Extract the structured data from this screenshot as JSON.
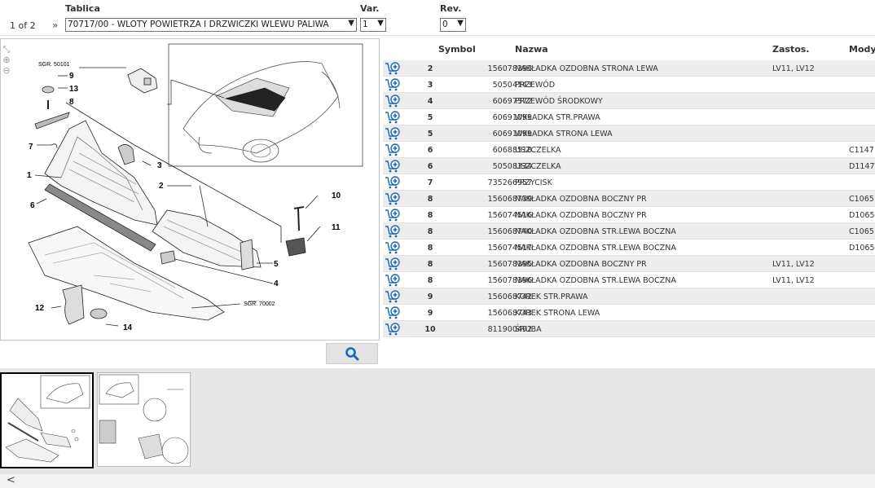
{
  "header": {
    "tablica_label": "Tablica",
    "var_label": "Var.",
    "rev_label": "Rev.",
    "page_indicator": "1 of 2",
    "nav_glyph": "»",
    "table_select": "70717/00 - WLOTY POWIETRZA I DRZWICZKI WLEWU PALIWA",
    "var_select": "1",
    "rev_select": "0"
  },
  "viewer": {
    "tools": [
      "⤡",
      "⊕",
      "⊖"
    ],
    "labels": {
      "sgr1": "SGR. 50101",
      "sgr2": "SGR. 70002",
      "n1": "1",
      "n2": "2",
      "n3": "3",
      "n4": "4",
      "n5": "5",
      "n6": "6",
      "n7": "7",
      "n8": "8",
      "n9": "9",
      "n10": "10",
      "n11": "11",
      "n12": "12",
      "n13": "13",
      "n14": "14"
    }
  },
  "table": {
    "columns": {
      "symbol": "Symbol",
      "nazwa": "Nazwa",
      "zastos": "Zastos.",
      "mody": "Mody"
    },
    "rows": [
      {
        "pos": "2",
        "symbol": "156078393",
        "nazwa": "NAKŁADKA OZDOBNA STRONA LEWA",
        "zastos": "LV11, LV12",
        "mody": ""
      },
      {
        "pos": "3",
        "symbol": "50504143",
        "nazwa": "PRZEWÓD",
        "zastos": "",
        "mody": ""
      },
      {
        "pos": "4",
        "symbol": "60697372",
        "nazwa": "PRZEWÓD ŚRODKOWY",
        "zastos": "",
        "mody": ""
      },
      {
        "pos": "5",
        "symbol": "60691099",
        "nazwa": "WKŁADKA STR.PRAWA",
        "zastos": "",
        "mody": ""
      },
      {
        "pos": "5",
        "symbol": "60691099",
        "nazwa": "WKŁADKA STRONA LEWA",
        "zastos": "",
        "mody": ""
      },
      {
        "pos": "6",
        "symbol": "60688518",
        "nazwa": "USZCZELKA",
        "zastos": "",
        "mody": "C1147"
      },
      {
        "pos": "6",
        "symbol": "50508334",
        "nazwa": "USZCZELKA",
        "zastos": "",
        "mody": "D1147"
      },
      {
        "pos": "7",
        "symbol": "735266957",
        "nazwa": "PRZYCISK",
        "zastos": "",
        "mody": ""
      },
      {
        "pos": "8",
        "symbol": "156068739",
        "nazwa": "NAKŁADKA OZDOBNA BOCZNY PR",
        "zastos": "",
        "mody": "C1065"
      },
      {
        "pos": "8",
        "symbol": "156074516",
        "nazwa": "NAKŁADKA OZDOBNA BOCZNY PR",
        "zastos": "",
        "mody": "D1065"
      },
      {
        "pos": "8",
        "symbol": "156068740",
        "nazwa": "NAKŁADKA OZDOBNA STR.LEWA BOCZNA",
        "zastos": "",
        "mody": "C1065"
      },
      {
        "pos": "8",
        "symbol": "156074517",
        "nazwa": "NAKŁADKA OZDOBNA STR.LEWA BOCZNA",
        "zastos": "",
        "mody": "D1065"
      },
      {
        "pos": "8",
        "symbol": "156078395",
        "nazwa": "NAKŁADKA OZDOBNA BOCZNY PR",
        "zastos": "LV11, LV12",
        "mody": ""
      },
      {
        "pos": "8",
        "symbol": "156078396",
        "nazwa": "NAKŁADKA OZDOBNA STR.LEWA BOCZNA",
        "zastos": "LV11, LV12",
        "mody": ""
      },
      {
        "pos": "9",
        "symbol": "156068742",
        "nazwa": "KOREK STR.PRAWA",
        "zastos": "",
        "mody": ""
      },
      {
        "pos": "9",
        "symbol": "156068743",
        "nazwa": "KOREK STRONA LEWA",
        "zastos": "",
        "mody": ""
      },
      {
        "pos": "10",
        "symbol": "811900492",
        "nazwa": "ŚRUBA",
        "zastos": "",
        "mody": ""
      }
    ]
  },
  "footer": {
    "back_glyph": "<"
  },
  "colors": {
    "icon_blue": "#1b67b8",
    "row_alt": "#ededed",
    "thumb_strip": "#e6e6e6"
  },
  "icons": [
    "zoom-fit-icon",
    "zoom-in-icon",
    "zoom-out-icon",
    "search-icon",
    "add-to-cart-icon",
    "chevron-down-icon",
    "back-arrow-icon"
  ]
}
